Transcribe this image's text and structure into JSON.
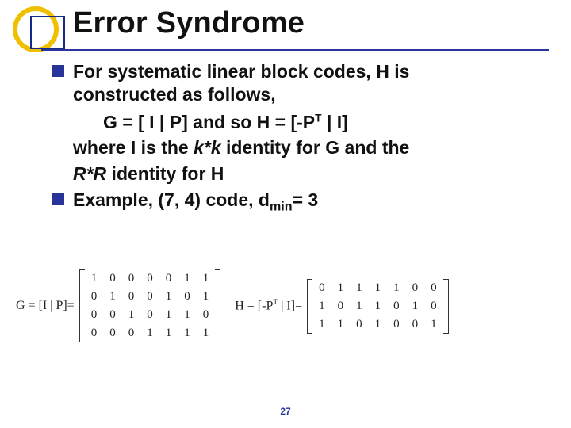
{
  "title": "Error Syndrome",
  "bullets": {
    "b1_line1": "For systematic linear block codes, H is",
    "b1_line2": "constructed as follows,",
    "eq_line_pre": "G = [ I | P]   and so   H = [-P",
    "eq_line_sup": "T",
    "eq_line_post": " | I]",
    "where_pre": "where I is the ",
    "kk": "k*k",
    "where_mid": " identity for G and the",
    "rr": "R*R",
    "where_end": " identity for H",
    "b2_pre": "Example, (7, 4) code, d",
    "b2_sub": "min",
    "b2_post": "= 3"
  },
  "matrices": {
    "G_label_pre": "G = ",
    "G_bracket": "[I | P]",
    "eq": "=",
    "H_label_pre": "H = ",
    "H_bracket_open": "[-P",
    "H_bracket_sup": "T",
    "H_bracket_close": " | I]",
    "G_rows": [
      [
        "1",
        "0",
        "0",
        "0",
        "0",
        "1",
        "1"
      ],
      [
        "0",
        "1",
        "0",
        "0",
        "1",
        "0",
        "1"
      ],
      [
        "0",
        "0",
        "1",
        "0",
        "1",
        "1",
        "0"
      ],
      [
        "0",
        "0",
        "0",
        "1",
        "1",
        "1",
        "1"
      ]
    ],
    "H_rows": [
      [
        "0",
        "1",
        "1",
        "1",
        "1",
        "0",
        "0"
      ],
      [
        "1",
        "0",
        "1",
        "1",
        "0",
        "1",
        "0"
      ],
      [
        "1",
        "1",
        "0",
        "1",
        "0",
        "0",
        "1"
      ]
    ]
  },
  "page": "27"
}
